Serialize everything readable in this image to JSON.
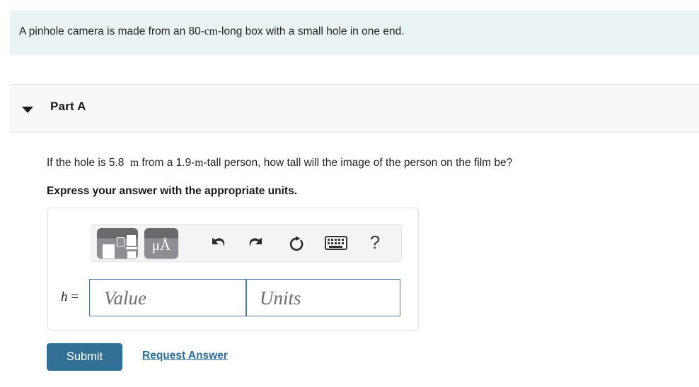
{
  "problem": {
    "statement_prefix": "A pinhole camera is made from an 80-",
    "statement_unit": "cm",
    "statement_suffix": "-long box with a small hole in one end."
  },
  "part": {
    "toggle_icon": "caret-down-icon",
    "title": "Part A",
    "question_prefix": "If the hole is 5.8  ",
    "question_unit1": "m",
    "question_middle": " from a 1.9-",
    "question_unit2": "m",
    "question_suffix": "-tall person, how tall will the image of the person on the film be?",
    "instruction": "Express your answer with the appropriate units."
  },
  "toolbar": {
    "template_button": {
      "name": "math-template-button",
      "label": "math templates"
    },
    "units_button": {
      "name": "units-symbols-button",
      "glyph": "μÅ"
    },
    "icons": [
      {
        "name": "undo-icon",
        "label": "Undo"
      },
      {
        "name": "redo-icon",
        "label": "Redo"
      },
      {
        "name": "reset-icon",
        "label": "Reset"
      },
      {
        "name": "keyboard-icon",
        "label": "Keyboard shortcuts"
      },
      {
        "name": "help-icon",
        "label": "?"
      }
    ],
    "help_glyph": "?"
  },
  "answer": {
    "variable_label": "h",
    "equals": "=",
    "value_placeholder": "Value",
    "units_placeholder": "Units",
    "value_current": "",
    "units_current": ""
  },
  "actions": {
    "submit_label": "Submit",
    "request_answer_label": "Request Answer"
  },
  "colors": {
    "statement_background": "#e9f3f4",
    "part_header_background": "#f8f8f8",
    "submit_background": "#337095",
    "link_color": "#2b6c96",
    "field_border": "#4c7a99",
    "toolbar_button": "#8e8e93"
  }
}
